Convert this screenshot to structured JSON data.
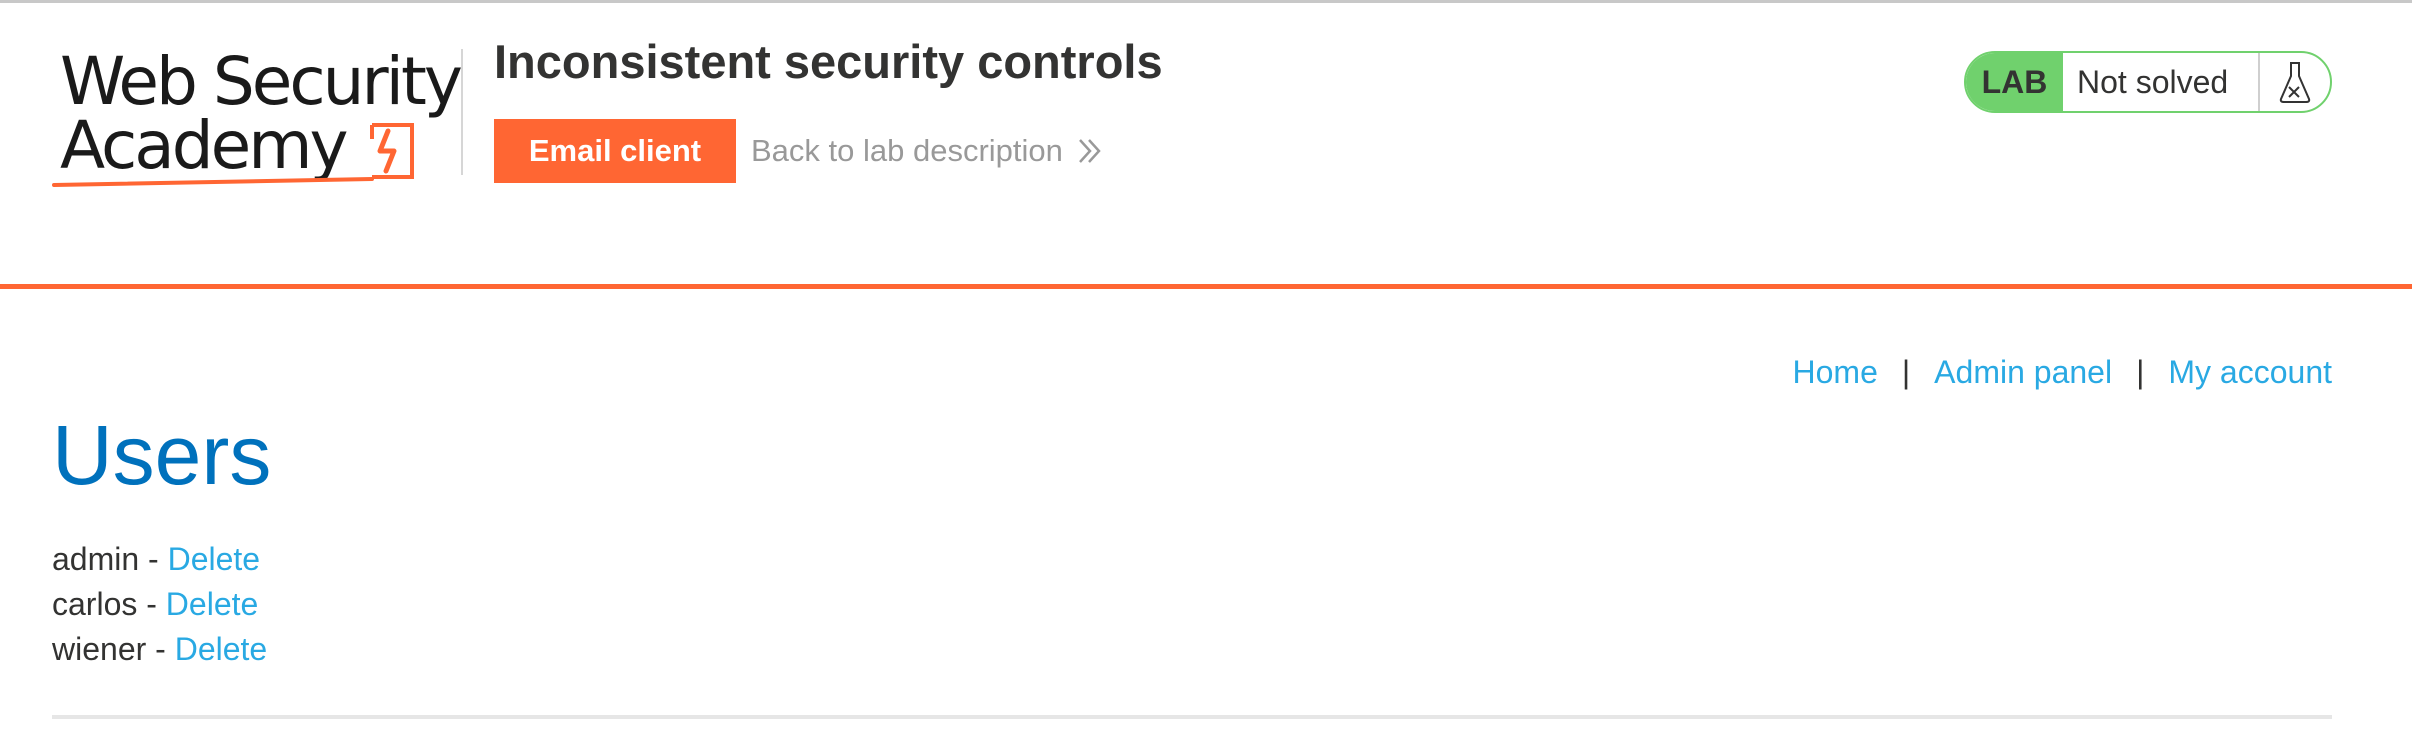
{
  "header": {
    "logo": {
      "line1": "Web Security",
      "line2": "Academy"
    },
    "lab_title": "Inconsistent security controls",
    "email_client_label": "Email client",
    "back_link_label": "Back to lab description",
    "lab_status": {
      "tag": "LAB",
      "state": "Not solved"
    }
  },
  "nav": {
    "items": [
      {
        "label": "Home"
      },
      {
        "label": "Admin panel"
      },
      {
        "label": "My account"
      }
    ],
    "separator": "|"
  },
  "main": {
    "heading": "Users",
    "users": [
      {
        "name": "admin",
        "separator": " - ",
        "action": "Delete"
      },
      {
        "name": "carlos",
        "separator": " - ",
        "action": "Delete"
      },
      {
        "name": "wiener",
        "separator": " - ",
        "action": "Delete"
      }
    ]
  },
  "colors": {
    "accent_orange": "#ff6633",
    "link_blue": "#29a9e3",
    "heading_blue": "#0071bc",
    "lab_green": "#70d16d"
  },
  "icons": {
    "logo_mark": "lightning-bracket-icon",
    "back_chevron": "double-chevron-right-icon",
    "lab_flask": "flask-icon"
  }
}
